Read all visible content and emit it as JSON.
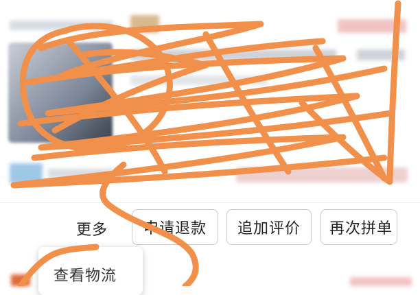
{
  "order_actions": {
    "more_label": "更多",
    "refund_label": "申请退款",
    "review_label": "追加评价",
    "rebuy_label": "再次拼单"
  },
  "more_menu": {
    "items": [
      {
        "label": "查看物流"
      }
    ]
  },
  "colors": {
    "scribble": "#F0904A",
    "button_border": "#C9C9C9",
    "text": "#222222"
  }
}
